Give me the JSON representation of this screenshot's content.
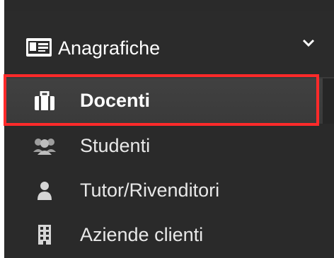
{
  "sidebar": {
    "section": {
      "label": "Anagrafiche",
      "icon": "id-card-icon",
      "expand_icon": "chevron-down-icon"
    },
    "items": [
      {
        "label": "Docenti",
        "icon": "briefcase-icon",
        "active": true
      },
      {
        "label": "Studenti",
        "icon": "users-icon",
        "active": false
      },
      {
        "label": "Tutor/Rivenditori",
        "icon": "user-icon",
        "active": false
      },
      {
        "label": "Aziende clienti",
        "icon": "building-icon",
        "active": false
      }
    ]
  },
  "colors": {
    "sidebar_bg": "#2a2a2a",
    "active_bg": "#3e3e3e",
    "highlight_border": "#ff2a2a",
    "text": "#e8e8e8"
  }
}
